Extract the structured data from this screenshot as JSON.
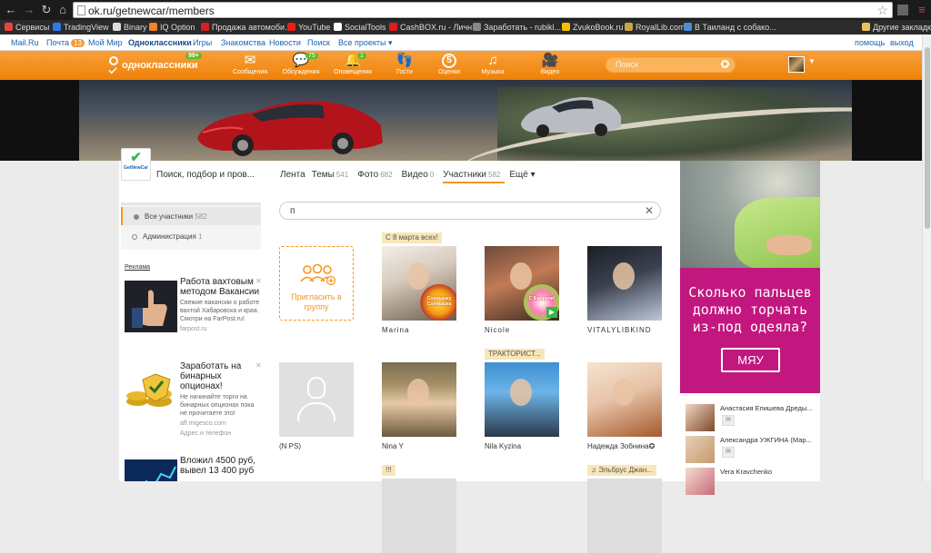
{
  "browser": {
    "url": "ok.ru/getnewcar/members",
    "bookmarks": [
      {
        "label": "Сервисы",
        "color": "#e8463b"
      },
      {
        "label": "TradingView",
        "color": "#2c7be5"
      },
      {
        "label": "Binary",
        "color": "#dddddd"
      },
      {
        "label": "IQ Option",
        "color": "#f5812b"
      },
      {
        "label": "Продажа автомоби...",
        "color": "#d71f1f"
      },
      {
        "label": "YouTube",
        "color": "#e62117"
      },
      {
        "label": "SocialTools",
        "color": "#ffffff"
      },
      {
        "label": "CashBOX.ru - Личн...",
        "color": "#e21b1b"
      },
      {
        "label": "Заработать - rubikl...",
        "color": "#888888"
      },
      {
        "label": "ZvukoBook.ru",
        "color": "#f2c200"
      },
      {
        "label": "RoyalLib.com",
        "color": "#caa24a"
      },
      {
        "label": "В Таиланд с собако...",
        "color": "#4a8fd4"
      }
    ],
    "other_bookmarks": "Другие закладки"
  },
  "portal": {
    "links": [
      "Mail.Ru",
      "Почта",
      "Мой Мир",
      "Одноклассники",
      "Игры",
      "Знакомства",
      "Новости",
      "Поиск",
      "Все проекты ▾"
    ],
    "mail_count": "13",
    "help": "помощь",
    "logout": "выход"
  },
  "toolbar": {
    "logo": "одноклассники",
    "logo_badge": "99+",
    "items": [
      {
        "label": "Сообщения",
        "icon": "envelope-icon",
        "glyph": "✉",
        "badge": ""
      },
      {
        "label": "Обсуждения",
        "icon": "chat-icon",
        "glyph": "💬",
        "badge": "75"
      },
      {
        "label": "Оповещения",
        "icon": "bell-icon",
        "glyph": "🔔",
        "badge": "1"
      },
      {
        "label": "Гости",
        "icon": "footprints-icon",
        "glyph": "👣",
        "badge": ""
      },
      {
        "label": "Оценки",
        "icon": "rating-icon",
        "glyph": "5",
        "badge": ""
      },
      {
        "label": "Музыка",
        "icon": "music-icon",
        "glyph": "♫",
        "badge": ""
      },
      {
        "label": "Видео",
        "icon": "video-icon",
        "glyph": "🎥",
        "badge": ""
      }
    ],
    "search_placeholder": "Поиск"
  },
  "group": {
    "logo_text": "GetNewCar",
    "name": "Поиск, подбор и пров...",
    "tabs": [
      {
        "label": "Лента",
        "count": ""
      },
      {
        "label": "Темы",
        "count": "541"
      },
      {
        "label": "Фото",
        "count": "682"
      },
      {
        "label": "Видео",
        "count": "0"
      },
      {
        "label": "Участники",
        "count": "582"
      },
      {
        "label": "Ещё ▾",
        "count": ""
      }
    ],
    "menu": [
      {
        "label": "Все участники",
        "count": "582"
      },
      {
        "label": "Администрация",
        "count": "1"
      }
    ]
  },
  "ads": {
    "label": "Реклама",
    "items": [
      {
        "title": "Работа вахтовым методом Вакансии",
        "text": "Свежие вакансии о работе вахтой Хабаровска и края. Смотри на FarPost.ru!",
        "source": "farpost.ru"
      },
      {
        "title": "Заработать на бинарных опционах!",
        "text": "Не начинайте торги на бинарных опционах пока не прочитаете это!",
        "source": "aff.migesco.com",
        "extra": "Адрес и телефон"
      },
      {
        "title": "Вложил 4500 руб, вывел 13 400 руб",
        "text": "",
        "source": ""
      }
    ]
  },
  "members": {
    "search_value": "п",
    "invite_label": "Пригласить в группу",
    "list": [
      {
        "name": "Marina",
        "label": "С 8 марта всех!",
        "sticker": "Солнышку Солнышка"
      },
      {
        "name": "Nicole",
        "label": "",
        "sticker": "С 8 апреля!"
      },
      {
        "name": "VITALYLIBKIND",
        "label": ""
      },
      {
        "name": "(N PS)",
        "label": ""
      },
      {
        "name": "Nina Y",
        "label": ""
      },
      {
        "name": "Nila Kyzina",
        "label": "ТРАКТОРИСТ..."
      },
      {
        "name": "Надежда Зобнина✪",
        "label": ""
      },
      {
        "name": "",
        "label": "!!!"
      },
      {
        "name": "",
        "label": "♫ Эльбрус Джан..."
      }
    ]
  },
  "right_ad": {
    "slogan": "Сколько пальцев должно торчать из-под одеяла?",
    "button": "МЯУ"
  },
  "friends": [
    {
      "name": "Анастасия Епишева Дреды..."
    },
    {
      "name": "Александра УЖГИНА (Мар..."
    },
    {
      "name": "Vera Kravchenko"
    }
  ]
}
